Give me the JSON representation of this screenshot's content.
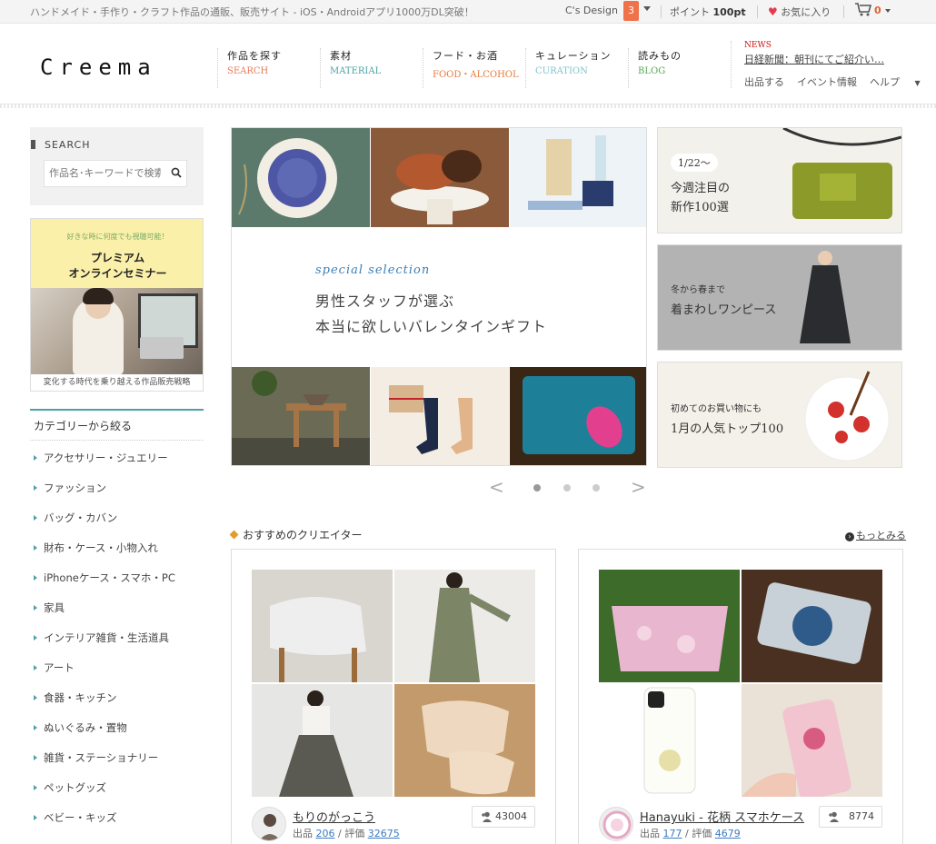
{
  "topbar": {
    "tagline": "ハンドメイド・手作り・クラフト作品の通販、販売サイト - iOS・Androidアプリ1000万DL突破！",
    "user_name": "C's Design",
    "notification_count": "3",
    "points_label": "ポイント",
    "points_value": "100pt",
    "favorites_label": "お気に入り",
    "cart_count": "0"
  },
  "header": {
    "logo": "Creema",
    "nav": [
      {
        "jp": "作品を探す",
        "en": "SEARCH",
        "color": "#e87a5a"
      },
      {
        "jp": "素材",
        "en": "MATERIAL",
        "color": "#4aa2a5"
      },
      {
        "jp": "フード・お酒",
        "en": "FOOD・ALCOHOL",
        "color": "#e8793a"
      },
      {
        "jp": "キュレーション",
        "en": "CURATION",
        "color": "#7fc3cf"
      },
      {
        "jp": "読みもの",
        "en": "BLOG",
        "color": "#5aa65a"
      }
    ],
    "news_label": "NEWS",
    "news_headline": "日経新聞：朝刊にてご紹介い…",
    "links": [
      "出品する",
      "イベント情報",
      "ヘルプ"
    ]
  },
  "sidebar": {
    "search_title": "SEARCH",
    "search_placeholder": "作品名･キーワードで検索",
    "seminar_small": "好きな時に何度でも視聴可能！",
    "seminar_line1": "プレミアム",
    "seminar_line2": "オンラインセミナー",
    "seminar_caption": "変化する時代を乗り越える作品販売戦略",
    "category_title": "カテゴリーから絞る",
    "categories": [
      "アクセサリー・ジュエリー",
      "ファッション",
      "バッグ・カバン",
      "財布・ケース・小物入れ",
      "iPhoneケース・スマホ・PC",
      "家具",
      "インテリア雑貨・生活道具",
      "アート",
      "食器・キッチン",
      "ぬいぐるみ・置物",
      "雑貨・ステーショナリー",
      "ペットグッズ",
      "ベビー・キッズ"
    ]
  },
  "banner": {
    "en": "special selection",
    "line1": "男性スタッフが選ぶ",
    "line2": "本当に欲しいバレンタインギフト"
  },
  "side_banners": [
    {
      "date": "1/22〜",
      "line1": "今週注目の",
      "line2": "新作100選"
    },
    {
      "line1": "冬から春まで",
      "line2": "着まわしワンピース"
    },
    {
      "line1": "初めてのお買い物にも",
      "line2": "1月の人気トップ100"
    }
  ],
  "carousel": {
    "prev": "<",
    "next": ">"
  },
  "creators_section": {
    "title": "おすすめのクリエイター",
    "more": "もっとみる",
    "creators": [
      {
        "name": "もりのがっこう",
        "works_label": "出品",
        "works": "206",
        "rating_label": "評価",
        "rating": "32675",
        "followers": "43004"
      },
      {
        "name": "Hanayuki - 花柄 スマホケース",
        "works_label": "出品",
        "works": "177",
        "rating_label": "評価",
        "rating": "4679",
        "followers": "8774"
      }
    ]
  }
}
